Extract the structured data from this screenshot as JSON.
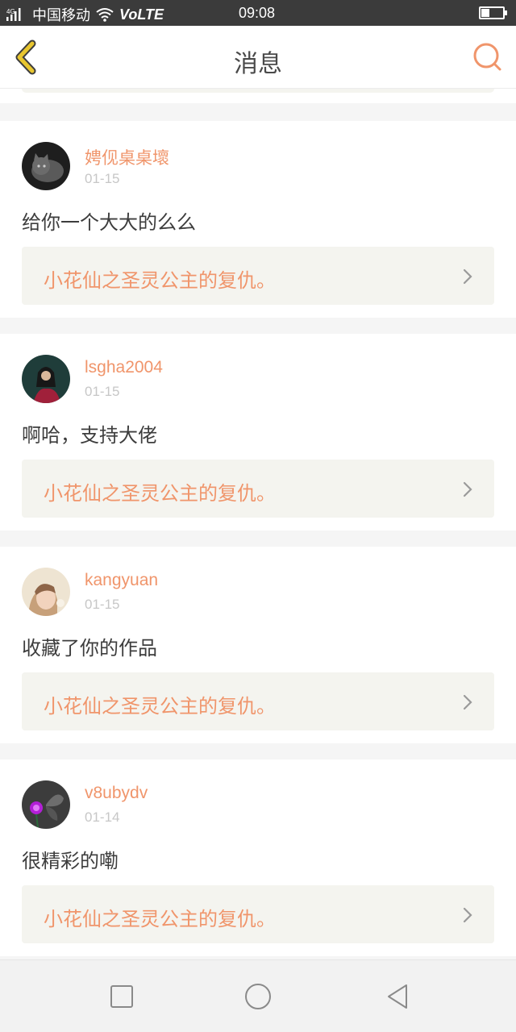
{
  "status_bar": {
    "signal_label": "4G",
    "carrier": "中国移动",
    "volte": "VoLTE",
    "time": "09:08",
    "battery_level": 0.4
  },
  "header": {
    "title": "消息",
    "back_icon": "chevron-left-icon",
    "search_icon": "search-icon"
  },
  "colors": {
    "accent": "#f0956b",
    "back_icon": "#e8c62f",
    "ref_bg": "#f4f4ef"
  },
  "messages": [
    {
      "username": "娉伣桌桌壞",
      "date": "01-15",
      "text": "给你一个大大的么么",
      "reference": "小花仙之圣灵公主的复仇。"
    },
    {
      "username": "lsgha2004",
      "date": "01-15",
      "text": "啊哈，支持大佬",
      "reference": "小花仙之圣灵公主的复仇。"
    },
    {
      "username": "kangyuan",
      "date": "01-15",
      "text": "收藏了你的作品",
      "reference": "小花仙之圣灵公主的复仇。"
    },
    {
      "username": "v8ubydv",
      "date": "01-14",
      "text": "很精彩的嘞",
      "reference": "小花仙之圣灵公主的复仇。"
    }
  ],
  "nav_bar": {
    "icons": [
      "square-icon",
      "circle-icon",
      "triangle-back-icon"
    ]
  }
}
